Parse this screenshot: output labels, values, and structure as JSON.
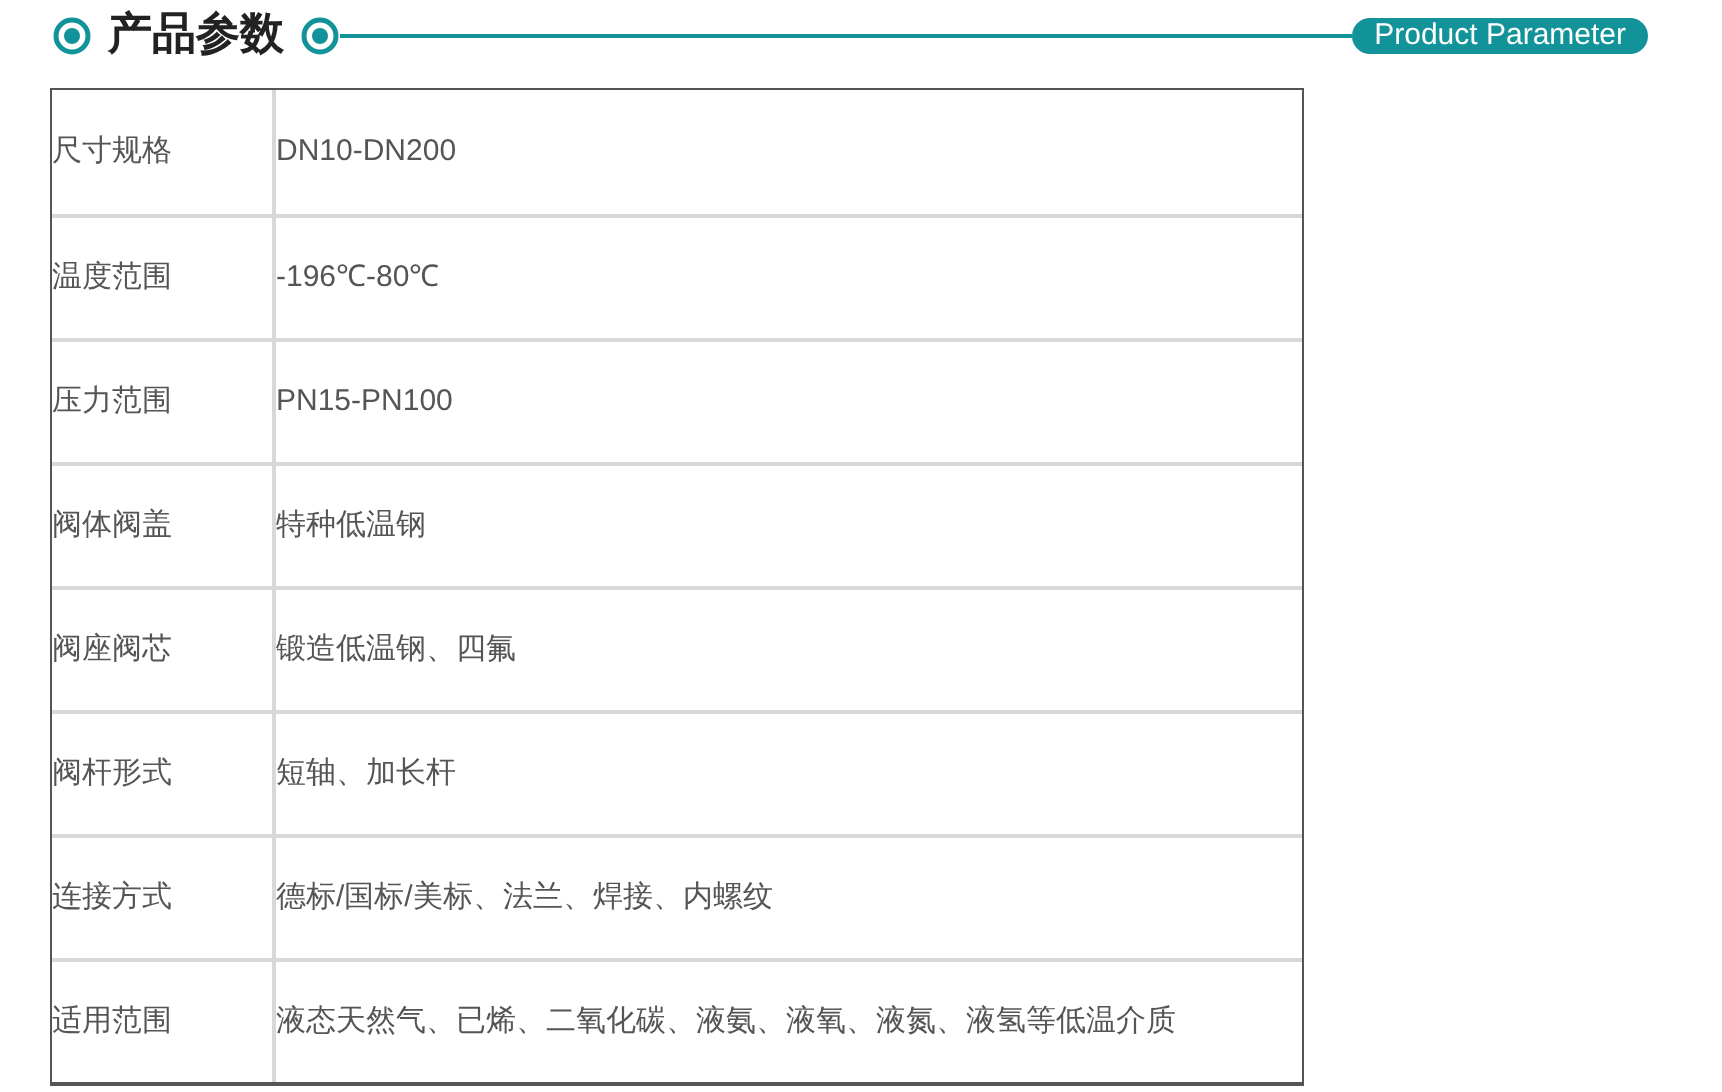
{
  "header": {
    "title": "产品参数",
    "badge": "Product Parameter"
  },
  "table": {
    "rows": [
      {
        "label": "尺寸规格",
        "value": "DN10-DN200"
      },
      {
        "label": "温度范围",
        "value": "-196℃-80℃"
      },
      {
        "label": "压力范围",
        "value": "PN15-PN100"
      },
      {
        "label": "阀体阀盖",
        "value": "特种低温钢"
      },
      {
        "label": "阀座阀芯",
        "value": "锻造低温钢、四氟"
      },
      {
        "label": "阀杆形式",
        "value": "短轴、加长杆"
      },
      {
        "label": "连接方式",
        "value": "德标/国标/美标、法兰、焊接、内螺纹"
      },
      {
        "label": "适用范围",
        "value": "液态天然气、已烯、二氧化碳、液氨、液氧、液氮、液氢等低温介质"
      }
    ]
  }
}
